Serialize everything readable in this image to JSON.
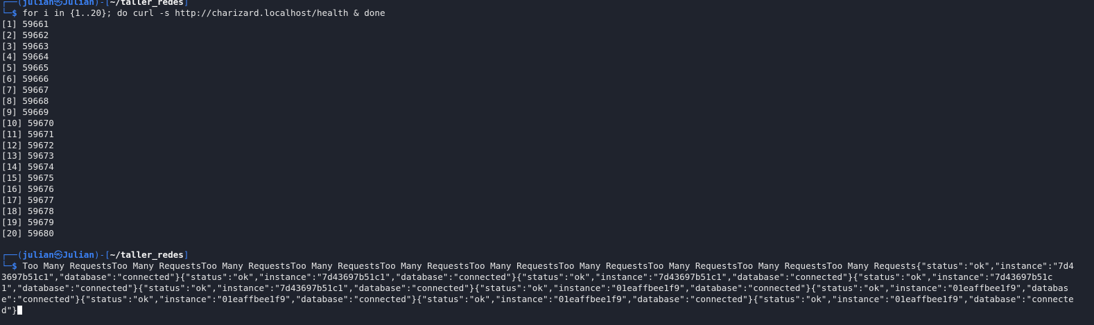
{
  "prompt": {
    "frame_open": "┌──(",
    "user": "julian",
    "at_symbol": "㉿",
    "host": "Julian",
    "frame_mid": ")-[",
    "path": "~/taller_redes",
    "frame_close": "]",
    "frame_bottom": "└─",
    "dollar": "$"
  },
  "command1": "for i in {1..20}; do curl -s http://charizard.localhost/health & done",
  "jobs": [
    "[1] 59661",
    "[2] 59662",
    "[3] 59663",
    "[4] 59664",
    "[5] 59665",
    "[6] 59666",
    "[7] 59667",
    "[8] 59668",
    "[9] 59669",
    "[10] 59670",
    "[11] 59671",
    "[12] 59672",
    "[13] 59673",
    "[14] 59674",
    "[15] 59675",
    "[16] 59676",
    "[17] 59677",
    "[18] 59678",
    "[19] 59679",
    "[20] 59680"
  ],
  "output": "Too Many RequestsToo Many RequestsToo Many RequestsToo Many RequestsToo Many RequestsToo Many RequestsToo Many RequestsToo Many RequestsToo Many RequestsToo Many Requests{\"status\":\"ok\",\"instance\":\"7d43697b51c1\",\"database\":\"connected\"}{\"status\":\"ok\",\"instance\":\"7d43697b51c1\",\"database\":\"connected\"}{\"status\":\"ok\",\"instance\":\"7d43697b51c1\",\"database\":\"connected\"}{\"status\":\"ok\",\"instance\":\"7d43697b51c1\",\"database\":\"connected\"}{\"status\":\"ok\",\"instance\":\"7d43697b51c1\",\"database\":\"connected\"}{\"status\":\"ok\",\"instance\":\"01eaffbee1f9\",\"database\":\"connected\"}{\"status\":\"ok\",\"instance\":\"01eaffbee1f9\",\"database\":\"connected\"}{\"status\":\"ok\",\"instance\":\"01eaffbee1f9\",\"database\":\"connected\"}{\"status\":\"ok\",\"instance\":\"01eaffbee1f9\",\"database\":\"connected\"}{\"status\":\"ok\",\"instance\":\"01eaffbee1f9\",\"database\":\"connected\"}",
  "colors": {
    "background": "#1f232d",
    "prompt_accent": "#3b82f6",
    "text": "#e6e6e6"
  }
}
